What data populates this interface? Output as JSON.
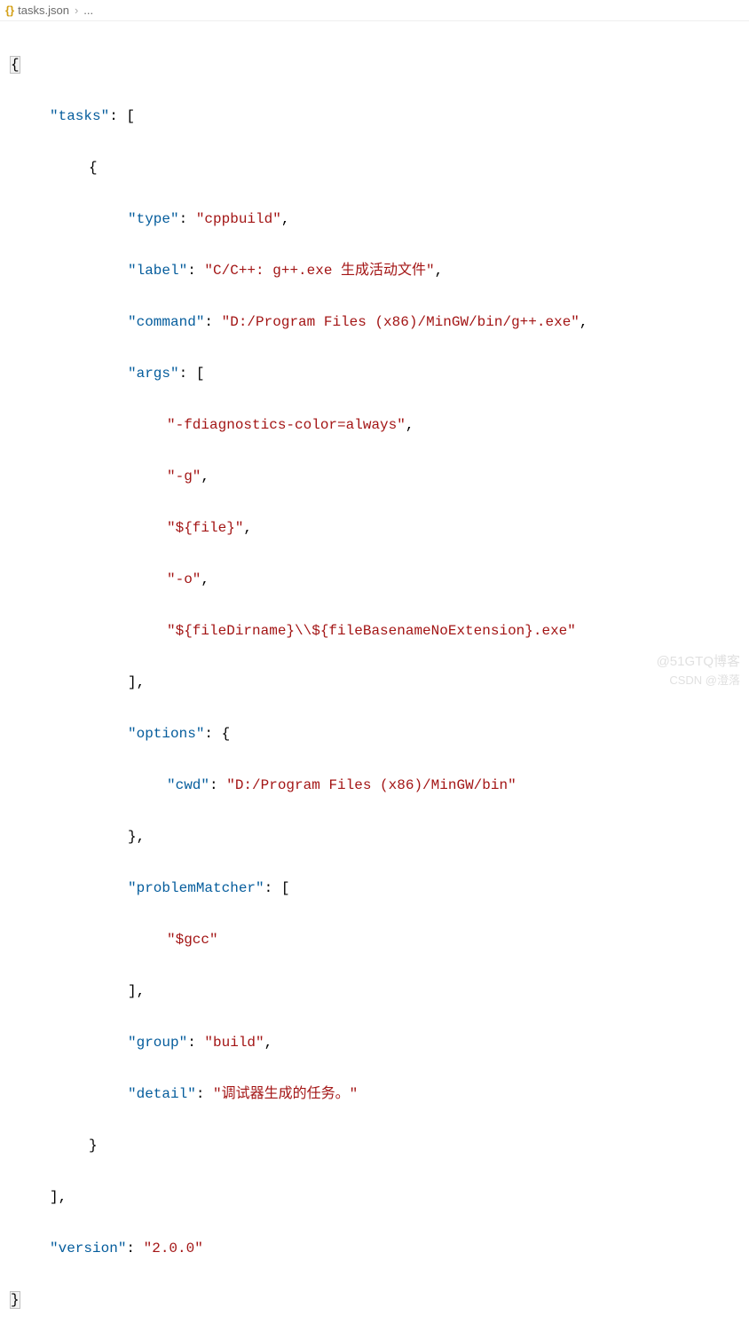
{
  "breadcrumb": {
    "icon": "{}",
    "filename": "tasks.json",
    "rest": "..."
  },
  "code": {
    "k_tasks": "\"tasks\"",
    "k_type": "\"type\"",
    "v_type": "\"cppbuild\"",
    "k_label": "\"label\"",
    "v_label": "\"C/C++: g++.exe 生成活动文件\"",
    "k_command": "\"command\"",
    "v_command": "\"D:/Program Files (x86)/MinGW/bin/g++.exe\"",
    "k_args": "\"args\"",
    "arg0": "\"-fdiagnostics-color=always\"",
    "arg1": "\"-g\"",
    "arg2": "\"${file}\"",
    "arg3": "\"-o\"",
    "arg4": "\"${fileDirname}\\\\${fileBasenameNoExtension}.exe\"",
    "k_options": "\"options\"",
    "k_cwd": "\"cwd\"",
    "v_cwd": "\"D:/Program Files (x86)/MinGW/bin\"",
    "k_problemMatcher": "\"problemMatcher\"",
    "v_pm0": "\"$gcc\"",
    "k_group": "\"group\"",
    "v_group": "\"build\"",
    "k_detail": "\"detail\"",
    "v_detail": "\"调试器生成的任务。\"",
    "k_version": "\"version\"",
    "v_version": "\"2.0.0\""
  },
  "watermark1": "@51GTQ博客",
  "watermark2": "CSDN @澄落"
}
